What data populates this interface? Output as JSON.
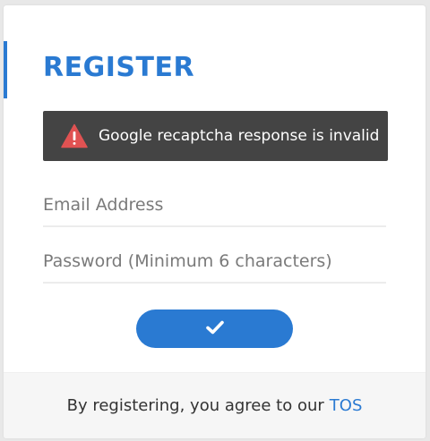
{
  "form": {
    "title": "REGISTER",
    "alert": {
      "message": "Google recaptcha response is invalid",
      "icon": "warning-triangle-icon"
    },
    "email": {
      "placeholder": "Email Address",
      "value": ""
    },
    "password": {
      "placeholder": "Password (Minimum 6 characters)",
      "value": ""
    },
    "submit": {
      "icon": "checkmark-icon"
    }
  },
  "footer": {
    "text": "By registering, you agree to our",
    "link_label": "TOS"
  },
  "colors": {
    "accent": "#2a7ad2",
    "alert_background": "#444444",
    "alert_icon": "#e05252"
  }
}
